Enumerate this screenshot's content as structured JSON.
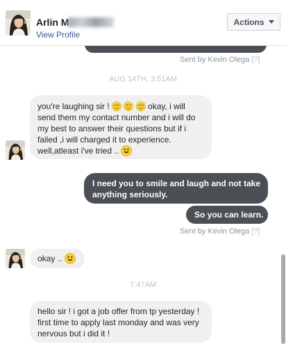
{
  "header": {
    "contact_name": "Arlin M",
    "view_profile": "View Profile",
    "actions_label": "Actions"
  },
  "messages": {
    "sent_meta_1": "Sent by Kevin Olega",
    "divider_1": "AUG 14TH, 3:51AM",
    "in_1_part1": "you're laughing sir ! ",
    "in_1_part2": " okay, i will",
    "in_1_line2": "send them my contact number and i will do",
    "in_1_line3": "my best to answer their questions but if i",
    "in_1_line4": "failed ,i will charged it to experience.",
    "in_1_line5": "well,atleast i've tried .. ",
    "out_1_line1": "I need you to smile and laugh and not take",
    "out_1_line2": "anything seriously.",
    "out_2": "So you can learn.",
    "sent_meta_2": "Sent by Kevin Olega",
    "in_2": "okay .. ",
    "divider_2": "7:47AM",
    "in_3_line1": "hello sir ! i got  a job offer from tp yesterday !",
    "in_3_line2": "first time to  apply last monday and was very",
    "in_3_line3": "nervous but i did it !",
    "help_mark": "[?]"
  },
  "colors": {
    "incoming_bubble": "#f1f0f0",
    "outgoing_bubble": "#4b4f56",
    "link": "#365899",
    "emoji_yellow": "#f7d23c"
  },
  "icons": {
    "actions_caret": "chevron-down-icon",
    "smiley": "smiley-emoji-icon",
    "blush": "blush-emoji-icon"
  }
}
